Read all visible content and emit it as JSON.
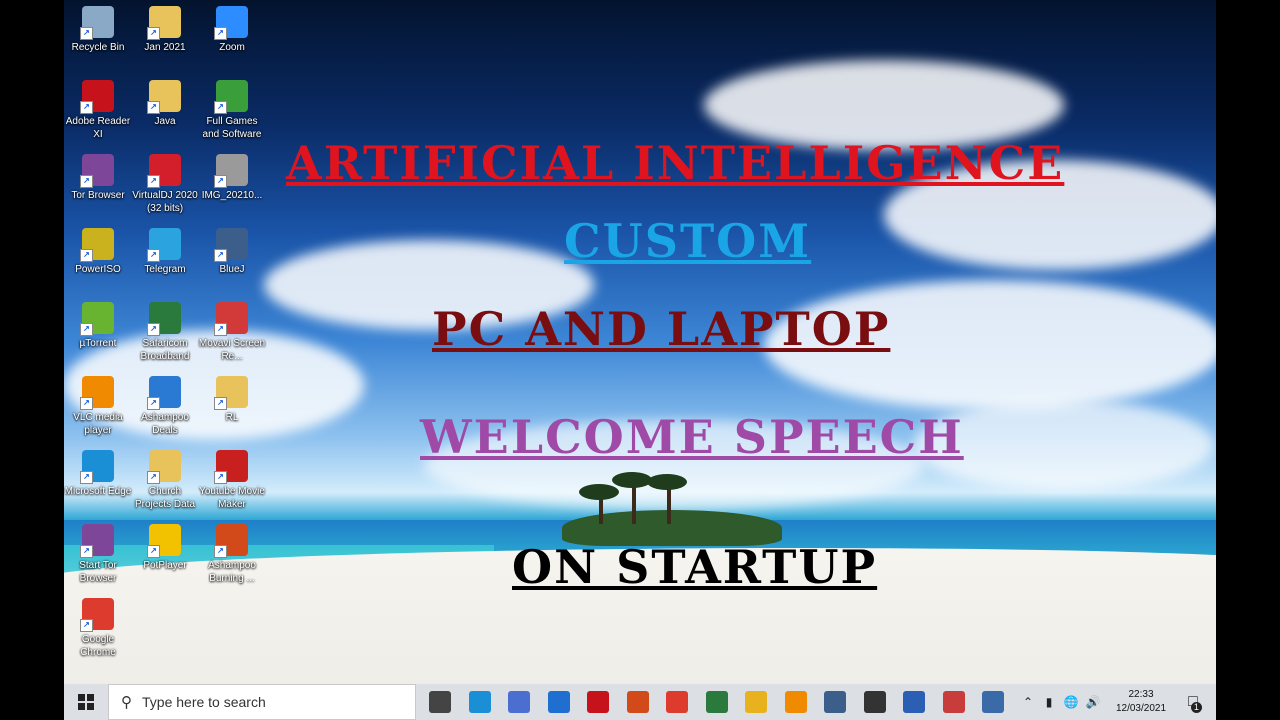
{
  "desktop": {
    "icons": [
      {
        "label": "Recycle Bin",
        "icon": "recycle-bin-icon",
        "color": "#8aa9c6"
      },
      {
        "label": "Jan 2021",
        "icon": "folder-icon",
        "color": "#e8c25a"
      },
      {
        "label": "Zoom",
        "icon": "zoom-icon",
        "color": "#2d8cff"
      },
      {
        "label": "Adobe Reader XI",
        "icon": "adobe-reader-icon",
        "color": "#c5121b"
      },
      {
        "label": "Java",
        "icon": "folder-icon",
        "color": "#e8c25a"
      },
      {
        "label": "Full Games and Software",
        "icon": "games-icon",
        "color": "#3a9e3a"
      },
      {
        "label": "Tor Browser",
        "icon": "tor-browser-icon",
        "color": "#7d4698"
      },
      {
        "label": "VirtualDJ 2020 (32 bits)",
        "icon": "virtualdj-icon",
        "color": "#d21f2b"
      },
      {
        "label": "IMG_20210...",
        "icon": "image-file-icon",
        "color": "#9a9a9a"
      },
      {
        "label": "PowerISO",
        "icon": "poweriso-icon",
        "color": "#c9b21e"
      },
      {
        "label": "Telegram",
        "icon": "telegram-icon",
        "color": "#2aa3df"
      },
      {
        "label": "BlueJ",
        "icon": "bluej-icon",
        "color": "#3b5f8a"
      },
      {
        "label": "µTorrent",
        "icon": "utorrent-icon",
        "color": "#68b32f"
      },
      {
        "label": "Safaricom Broadband",
        "icon": "safaricom-icon",
        "color": "#2b7a3d"
      },
      {
        "label": "Movavi Screen Re...",
        "icon": "movavi-icon",
        "color": "#d23a3a"
      },
      {
        "label": "VLC media player",
        "icon": "vlc-icon",
        "color": "#f08a00"
      },
      {
        "label": "Ashampoo Deals",
        "icon": "ashampoo-deals-icon",
        "color": "#2a7ad3"
      },
      {
        "label": "RL",
        "icon": "file-icon",
        "color": "#e8c25a"
      },
      {
        "label": "Microsoft Edge",
        "icon": "edge-icon",
        "color": "#1b8fd6"
      },
      {
        "label": "Church Projects Data",
        "icon": "folder-icon",
        "color": "#e8c25a"
      },
      {
        "label": "Youtube Movie Maker",
        "icon": "youtube-movie-maker-icon",
        "color": "#c81f1f"
      },
      {
        "label": "Start Tor Browser",
        "icon": "tor-browser-icon",
        "color": "#7d4698"
      },
      {
        "label": "PotPlayer",
        "icon": "potplayer-icon",
        "color": "#f2c200"
      },
      {
        "label": "Ashampoo Burning ...",
        "icon": "ashampoo-burning-icon",
        "color": "#d24a1a"
      },
      {
        "label": "Google Chrome",
        "icon": "chrome-icon",
        "color": "#de3b2f"
      }
    ]
  },
  "headlines": {
    "line1": "ARTIFICIAL INTELLIGENCE",
    "line2": "CUSTOM",
    "line3": "PC AND LAPTOP",
    "line4": "WELCOME SPEECH",
    "line5": "ON STARTUP"
  },
  "colors": {
    "line1": "#e0141f",
    "line2": "#1aa6e6",
    "line3": "#7a0d10",
    "line4": "#a04aa8",
    "line5": "#000000"
  },
  "taskbar": {
    "search_placeholder": "Type here to search",
    "pinned": [
      {
        "name": "task-view-icon",
        "color": "#444444"
      },
      {
        "name": "edge-icon",
        "color": "#1b8fd6"
      },
      {
        "name": "store-icon",
        "color": "#4a6fd1"
      },
      {
        "name": "mail-icon",
        "color": "#1f6fd0"
      },
      {
        "name": "adobe-reader-icon",
        "color": "#c5121b"
      },
      {
        "name": "ashampoo-burning-icon",
        "color": "#d24a1a"
      },
      {
        "name": "chrome-icon",
        "color": "#de3b2f"
      },
      {
        "name": "safaricom-icon",
        "color": "#2b7a3d"
      },
      {
        "name": "file-explorer-icon",
        "color": "#e8b21e"
      },
      {
        "name": "vlc-icon",
        "color": "#f08a00"
      },
      {
        "name": "bluej-icon",
        "color": "#3b5f8a"
      },
      {
        "name": "settings-icon",
        "color": "#333333"
      },
      {
        "name": "word-icon",
        "color": "#2b5fb4"
      },
      {
        "name": "paint-icon",
        "color": "#c93c3c"
      },
      {
        "name": "calculator-icon",
        "color": "#3a6aa8"
      }
    ],
    "clock_time": "22:33",
    "clock_date": "12/03/2021",
    "notification_count": "1"
  }
}
